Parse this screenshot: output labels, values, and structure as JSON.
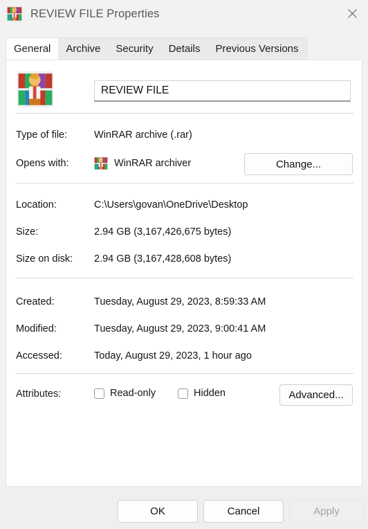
{
  "window": {
    "title": "REVIEW FILE Properties",
    "title_icon": "winrar-icon",
    "close_icon": "close-icon"
  },
  "tabs": [
    {
      "label": "General",
      "active": true
    },
    {
      "label": "Archive",
      "active": false
    },
    {
      "label": "Security",
      "active": false
    },
    {
      "label": "Details",
      "active": false
    },
    {
      "label": "Previous Versions",
      "active": false
    }
  ],
  "general": {
    "file_icon": "winrar-archive-icon",
    "filename": "REVIEW FILE",
    "rows": [
      {
        "label": "Type of file:",
        "value": "WinRAR archive (.rar)"
      },
      {
        "label": "Opens with:",
        "value": "WinRAR archiver",
        "icon": "winrar-icon"
      },
      {
        "label": "Location:",
        "value": "C:\\Users\\govan\\OneDrive\\Desktop"
      },
      {
        "label": "Size:",
        "value": "2.94 GB (3,167,426,675 bytes)"
      },
      {
        "label": "Size on disk:",
        "value": "2.94 GB (3,167,428,608 bytes)"
      },
      {
        "label": "Created:",
        "value": "Tuesday, August 29, 2023, 8:59:33 AM"
      },
      {
        "label": "Modified:",
        "value": "Tuesday, August 29, 2023, 9:00:41 AM"
      },
      {
        "label": "Accessed:",
        "value": "Today, August 29, 2023, 1 hour ago"
      }
    ],
    "change_button": "Change...",
    "attributes": {
      "label": "Attributes:",
      "readonly": {
        "label": "Read-only",
        "checked": false
      },
      "hidden": {
        "label": "Hidden",
        "checked": false
      },
      "advanced_button": "Advanced..."
    }
  },
  "footer": {
    "ok": "OK",
    "cancel": "Cancel",
    "apply": "Apply",
    "apply_enabled": false
  },
  "colors": {
    "window_bg": "#f2f2f2",
    "panel_bg": "#ffffff",
    "footer_bg": "#efefef",
    "tab_active_bg": "#ffffff",
    "tabstrip_bg": "#eaeaea",
    "separator": "#d8d8d8",
    "title_text": "#585858",
    "disabled_text": "#a4a4a4"
  }
}
